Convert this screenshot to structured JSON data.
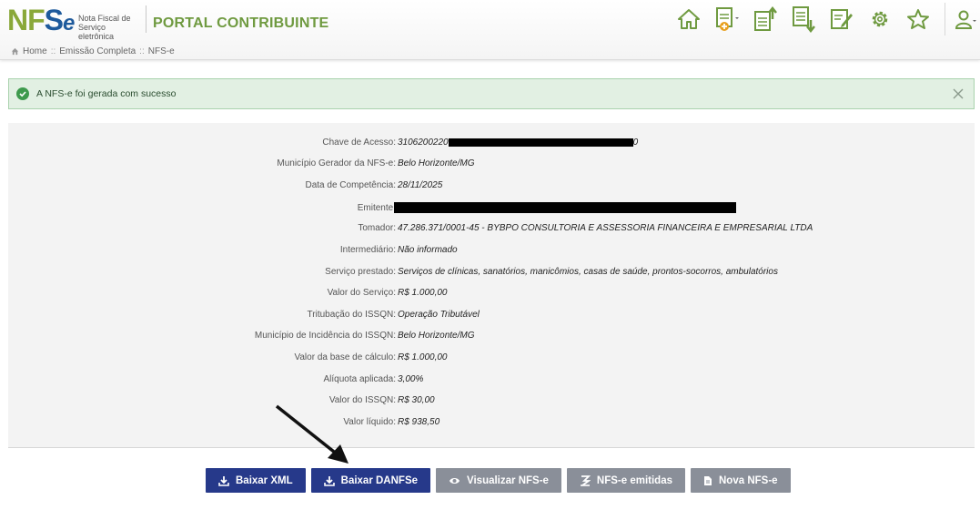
{
  "header": {
    "logo_text": "NFSe",
    "logo_subtitle": "Nota Fiscal de Serviço eletrônica",
    "portal_title": "PORTAL CONTRIBUINTE"
  },
  "breadcrumb": {
    "items": [
      "Home",
      "Emissão Completa",
      "NFS-e"
    ],
    "separator": "::"
  },
  "toolbar": {
    "icons": [
      "home-icon",
      "new-invoice-icon",
      "upload-document-icon",
      "download-document-icon",
      "edit-document-icon",
      "gear-icon",
      "star-icon",
      "user-icon"
    ],
    "new_invoice_badge": "NFSe"
  },
  "alert": {
    "message": "A NFS-e foi gerada com sucesso"
  },
  "details": [
    {
      "label": "Chave de Acesso:",
      "value_prefix": "3106200220",
      "value_suffix": "0",
      "redacted": true
    },
    {
      "label": "Município Gerador da NFS-e:",
      "value": "Belo Horizonte/MG"
    },
    {
      "label": "Data de Competência:",
      "value": "28/11/2025"
    },
    {
      "label": "Emitente:",
      "value": "",
      "redacted": true
    },
    {
      "label": "Tomador:",
      "value": "47.286.371/0001-45 - BYBPO CONSULTORIA E ASSESSORIA FINANCEIRA E EMPRESARIAL LTDA"
    },
    {
      "label": "Intermediário:",
      "value": "Não informado"
    },
    {
      "label": "Serviço prestado:",
      "value": "Serviços de clínicas, sanatórios, manicômios, casas de saúde, prontos-socorros, ambulatórios"
    },
    {
      "label": "Valor do Serviço:",
      "value": "R$ 1.000,00"
    },
    {
      "label": "Tritubação do ISSQN:",
      "value": "Operação Tributável"
    },
    {
      "label": "Município de Incidência do ISSQN:",
      "value": "Belo Horizonte/MG"
    },
    {
      "label": "Valor da base de cálculo:",
      "value": "R$ 1.000,00"
    },
    {
      "label": "Alíquota aplicada:",
      "value": "3,00%"
    },
    {
      "label": "Valor do ISSQN:",
      "value": "R$ 30,00"
    },
    {
      "label": "Valor líquido:",
      "value": "R$ 938,50"
    }
  ],
  "actions": {
    "baixar_xml": "Baixar XML",
    "baixar_danfse": "Baixar DANFSe",
    "visualizar": "Visualizar NFS-e",
    "emitidas": "NFS-e emitidas",
    "nova": "Nova NFS-e"
  },
  "colors": {
    "primary_button": "#26398a",
    "secondary_button": "#8a8f99",
    "brand_green": "#6f9a40",
    "brand_blue": "#1e5a9c",
    "alert_bg": "#e2f0e3"
  }
}
